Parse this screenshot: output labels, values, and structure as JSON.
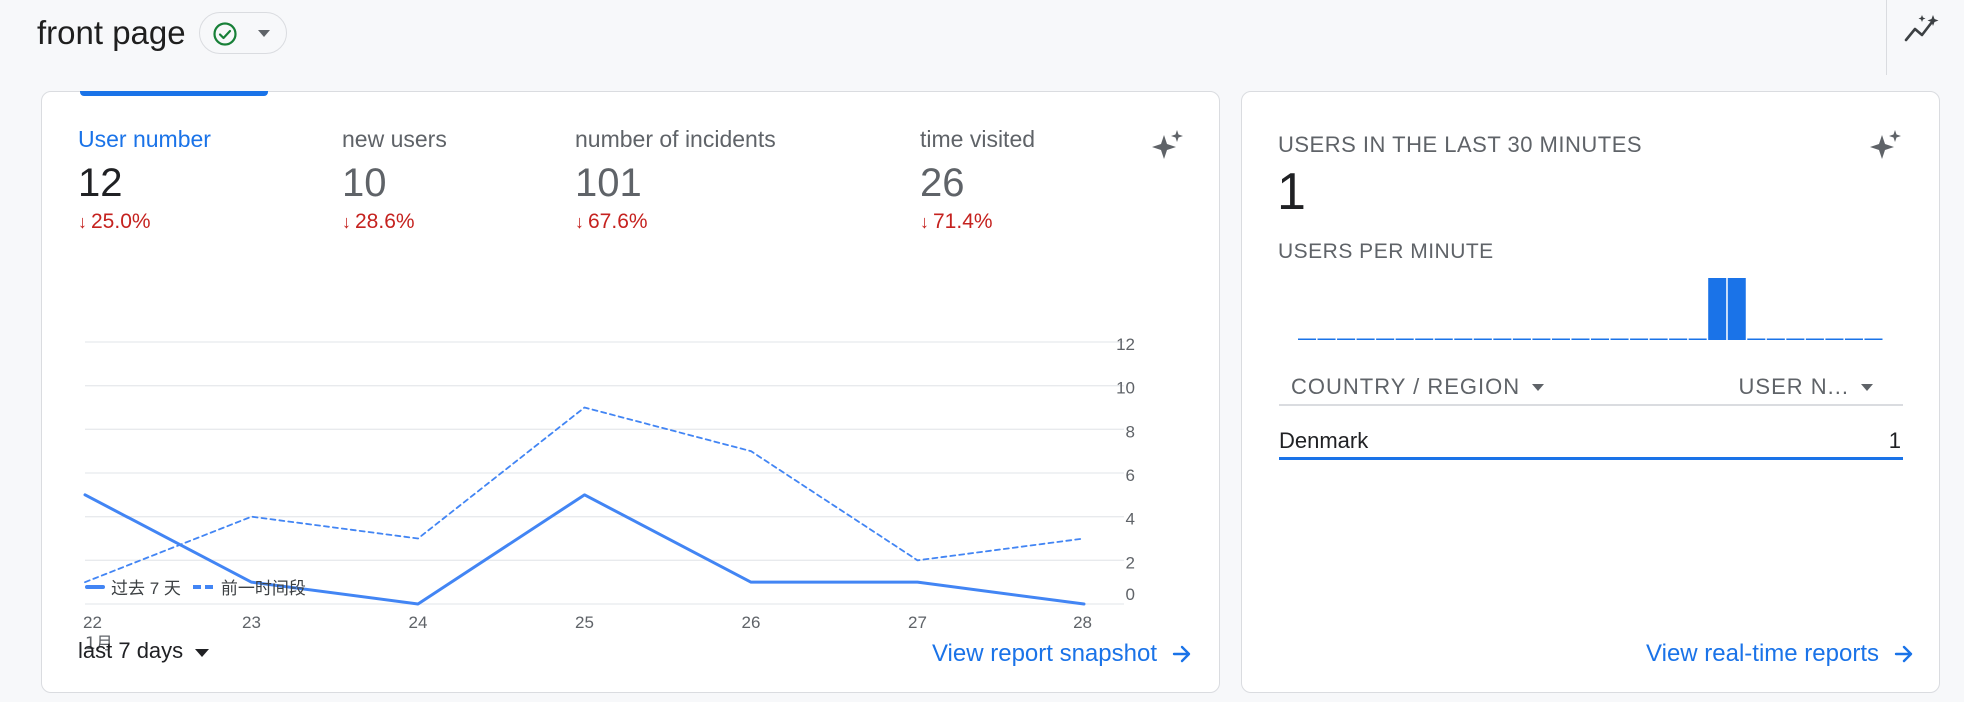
{
  "header": {
    "title": "front page",
    "status_icon": "check-circle-icon",
    "insights_icon": "insights-icon"
  },
  "colors": {
    "accent": "#1a73e8",
    "line": "#4285f4",
    "negative": "#c5221f",
    "status_ok": "#188038"
  },
  "metrics": [
    {
      "label": "User number",
      "value": "12",
      "change": "25.0%",
      "direction": "down",
      "active": true
    },
    {
      "label": "new users",
      "value": "10",
      "change": "28.6%",
      "direction": "down",
      "active": false
    },
    {
      "label": "number of incidents",
      "value": "101",
      "change": "67.6%",
      "direction": "down",
      "active": false
    },
    {
      "label": "time visited",
      "value": "26",
      "change": "71.4%",
      "direction": "down",
      "active": false
    }
  ],
  "chart_data": {
    "type": "line",
    "categories": [
      "22",
      "23",
      "24",
      "25",
      "26",
      "27",
      "28"
    ],
    "x_sublabel": "1月",
    "yticks": [
      0,
      2,
      4,
      6,
      8,
      10,
      12
    ],
    "ylim": [
      0,
      12
    ],
    "grid": true,
    "series": [
      {
        "name": "过去 7 天",
        "style": "solid",
        "values": [
          5,
          1,
          0,
          5,
          1,
          1,
          0
        ]
      },
      {
        "name": "前一时间段",
        "style": "dashed",
        "values": [
          1,
          4,
          3,
          9,
          7,
          2,
          3
        ]
      }
    ]
  },
  "range": {
    "label": "last 7 days"
  },
  "links": {
    "snapshot": "View report snapshot",
    "realtime": "View real-time reports"
  },
  "realtime": {
    "heading": "USERS IN THE LAST 30 MINUTES",
    "value": "1",
    "per_minute_label": "USERS PER MINUTE",
    "per_minute": [
      0,
      0,
      0,
      0,
      0,
      0,
      0,
      0,
      0,
      0,
      0,
      0,
      0,
      0,
      0,
      0,
      0,
      0,
      0,
      0,
      0,
      1,
      1,
      0,
      0,
      0,
      0,
      0,
      0,
      0
    ],
    "table": {
      "columns": [
        "COUNTRY / REGION",
        "USER N..."
      ],
      "rows": [
        {
          "country": "Denmark",
          "users": "1"
        }
      ]
    }
  }
}
